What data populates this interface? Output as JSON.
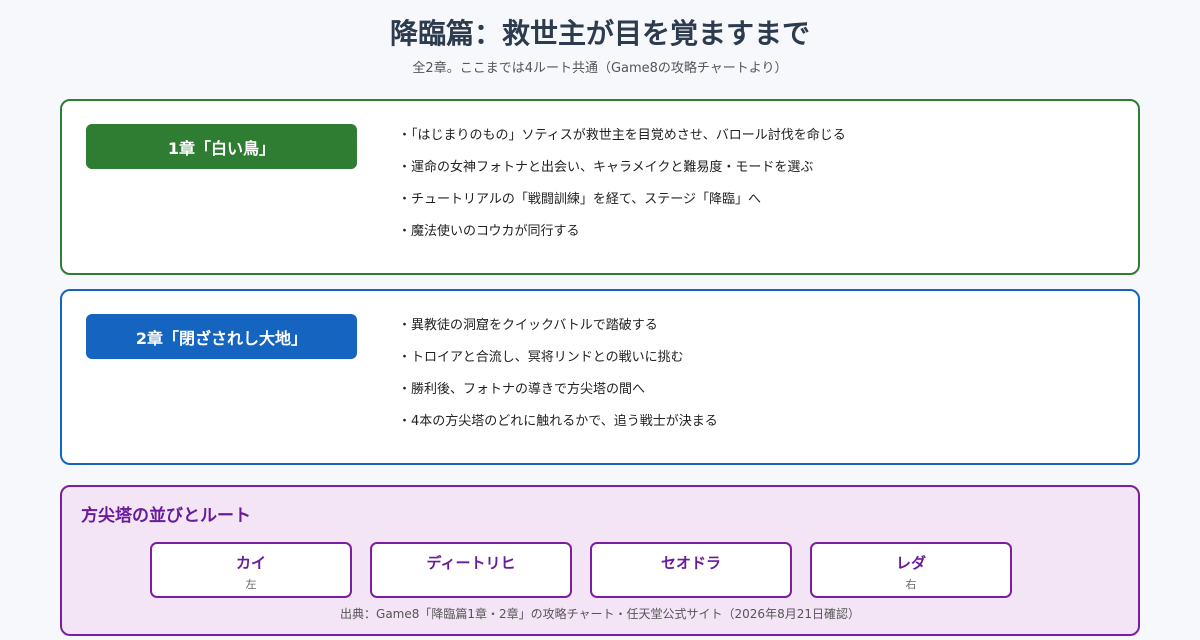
{
  "header": {
    "title": "降臨篇：救世主が目を覚ますまで",
    "subtitle": "全2章。ここまでは4ルート共通（Game8の攻略チャートより）"
  },
  "chapters": [
    {
      "label": "1章「白い鳥」",
      "color": "#2e7d32",
      "bullets": [
        "「はじまりのもの」ソティスが救世主を目覚めさせ、バロール討伐を命じる",
        "運命の女神フォトナと出会い、キャラメイクと難易度・モードを選ぶ",
        "チュートリアルの「戦闘訓練」を経て、ステージ「降臨」へ",
        "魔法使いのコウカが同行する"
      ]
    },
    {
      "label": "2章「閉ざされし大地」",
      "color": "#1565c0",
      "bullets": [
        "異教徒の洞窟をクイックバトルで踏破する",
        "トロイアと合流し、冥将リンドとの戦いに挑む",
        "勝利後、フォトナの導きで方尖塔の間へ",
        "4本の方尖塔のどれに触れるかで、追う戦士が決まる"
      ]
    }
  ],
  "routes": {
    "title": "方尖塔の並びとルート",
    "color": "#7b1fa2",
    "towers": [
      {
        "name": "カイ",
        "position": "左"
      },
      {
        "name": "ディートリヒ",
        "position": ""
      },
      {
        "name": "セオドラ",
        "position": ""
      },
      {
        "name": "レダ",
        "position": "右"
      }
    ],
    "source": "出典：Game8「降臨篇1章・2章」の攻略チャート・任天堂公式サイト（2026年8月21日確認）"
  }
}
